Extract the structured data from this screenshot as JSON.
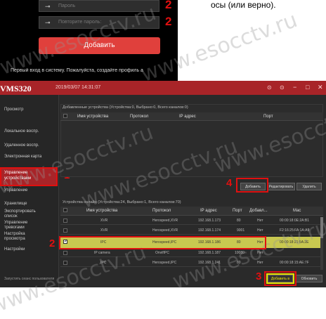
{
  "top": {
    "password_placeholder": "Пароль",
    "repeat_placeholder": "Повторите пароль:",
    "num_2a": "2",
    "num_2b": "2",
    "add_button": "Добавить",
    "first_login": "Первый вход в систему. Пожалуйста, создайте профиль а",
    "side_text": "осы (или верно)."
  },
  "watermark": "www.esocctv.ru",
  "app": {
    "title": "VMS320",
    "datetime": "2019/03/07 14:31:07",
    "win_icons": [
      "⊙",
      "⊙",
      "−",
      "□",
      "✕"
    ]
  },
  "sidebar": {
    "items": [
      "Просмотр",
      "Локальное воспр.",
      "Удаленное воспр.",
      "Электронная карта",
      "Управление устройствами",
      "Управление",
      "Хранилище",
      "Экспортировать список",
      "Управление тревогами",
      "Настройка просмотра",
      "Настройки"
    ],
    "footer": "Запустить сеанс пользователя"
  },
  "added": {
    "header": "Добавленные устройства   (Устройства:0, Выбрано:0, Всего каналов:0)",
    "cols": [
      "Имя устройства",
      "Протокол",
      "IP адрес",
      "Порт"
    ],
    "buttons": [
      "Добавить",
      "Редактировать",
      "Удалить"
    ]
  },
  "online": {
    "header": "Устройства онлайн   (Устройства:24, Выбрано:1, Всего каналов:70)",
    "cols": [
      "Имя устройства",
      "Протокол",
      "IP адрес",
      "Порт",
      "Добавл...",
      "Мас"
    ],
    "rows": [
      [
        "XVR",
        "Herospeed,XVR",
        "192.168.1.173",
        "80",
        "Нет",
        "00:00:18:0E:2A:B1"
      ],
      [
        "XVR",
        "Herospeed,XVR",
        "192.168.1.174",
        "9001",
        "Нет",
        "F2:16:25:FA:1A:A9"
      ],
      [
        "IPC",
        "Herospeed,IPC",
        "192.168.1.186",
        "80",
        "Нет",
        "00:00:18:21:5A:2E"
      ],
      [
        "IP camera",
        "OnvifIPC",
        "192.168.1.187",
        "10080",
        "Нет",
        ""
      ],
      [
        "IPC",
        "Herospeed,IPC",
        "192.168.1.241",
        "80",
        "Нет",
        "00:00:18:15:AE:7F"
      ]
    ],
    "buttons": [
      "Добавить в",
      "Обновить"
    ]
  },
  "annotations": {
    "n1": "1",
    "n2": "2",
    "n3": "3",
    "n4": "4"
  }
}
